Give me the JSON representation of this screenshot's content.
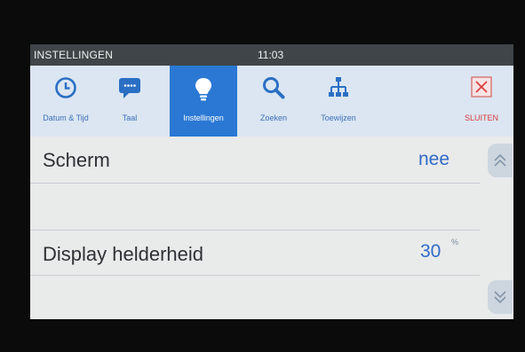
{
  "statusbar": {
    "title": "INSTELLINGEN",
    "time": "11:03"
  },
  "tabs": [
    {
      "label": "Datum & Tijd",
      "icon": "clock-icon"
    },
    {
      "label": "Taal",
      "icon": "chat-bubble-icon"
    },
    {
      "label": "Instellingen",
      "icon": "lightbulb-icon",
      "active": true
    },
    {
      "label": "Zoeken",
      "icon": "search-icon"
    },
    {
      "label": "Toewijzen",
      "icon": "hierarchy-icon"
    },
    {
      "label": "SLUITEN",
      "icon": "close-icon"
    }
  ],
  "settings": [
    {
      "label": "Scherm",
      "value": "nee",
      "unit": ""
    },
    {
      "label": "Display helderheid",
      "value": "30",
      "unit": "%"
    }
  ],
  "colors": {
    "accent": "#2a78d4",
    "link": "#3b6fb8",
    "danger": "#d93a3a",
    "statusbar": "#3f4548"
  }
}
